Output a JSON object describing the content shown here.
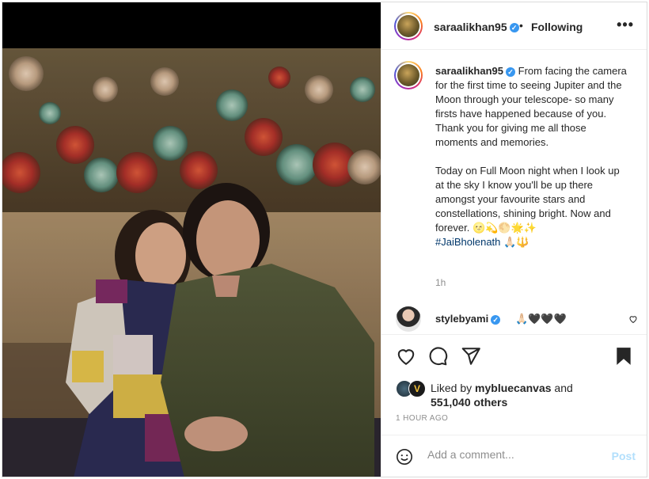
{
  "post": {
    "author": "saraalikhan95",
    "follow_separator": "•",
    "follow_status": "Following",
    "more_icon": "more-horizontal-icon",
    "verified_badge_color": "#3897f0"
  },
  "caption": {
    "author": "saraalikhan95",
    "paragraph1": "From facing the camera for the first time to seeing Jupiter and the Moon through your telescope- so many firsts have happened because of you. Thank you for giving me all those moments and memories.",
    "paragraph2": "Today on Full Moon night when I look up at the sky I know you'll be up there amongst your favourite stars and constellations, shining bright. Now and forever. 🌝💫🌕🌟✨",
    "hashtag": "#JaiBholenath",
    "hashtag_suffix": " 🙏🏻🔱",
    "time": "1h"
  },
  "comments": [
    {
      "user": "stylebyami",
      "text": "🙏🏻🖤🖤🖤"
    }
  ],
  "likes": {
    "prefix": "Liked by ",
    "liked_by": "mybluecanvas",
    "conjunction": " and",
    "others": "551,040 others"
  },
  "posted_ago": "1 HOUR AGO",
  "comment_box": {
    "placeholder": "Add a comment...",
    "post_label": "Post"
  },
  "colors": {
    "text": "#262626",
    "muted": "#8e8e8e",
    "link": "#00376b",
    "post_disabled": "#b2dffc"
  }
}
